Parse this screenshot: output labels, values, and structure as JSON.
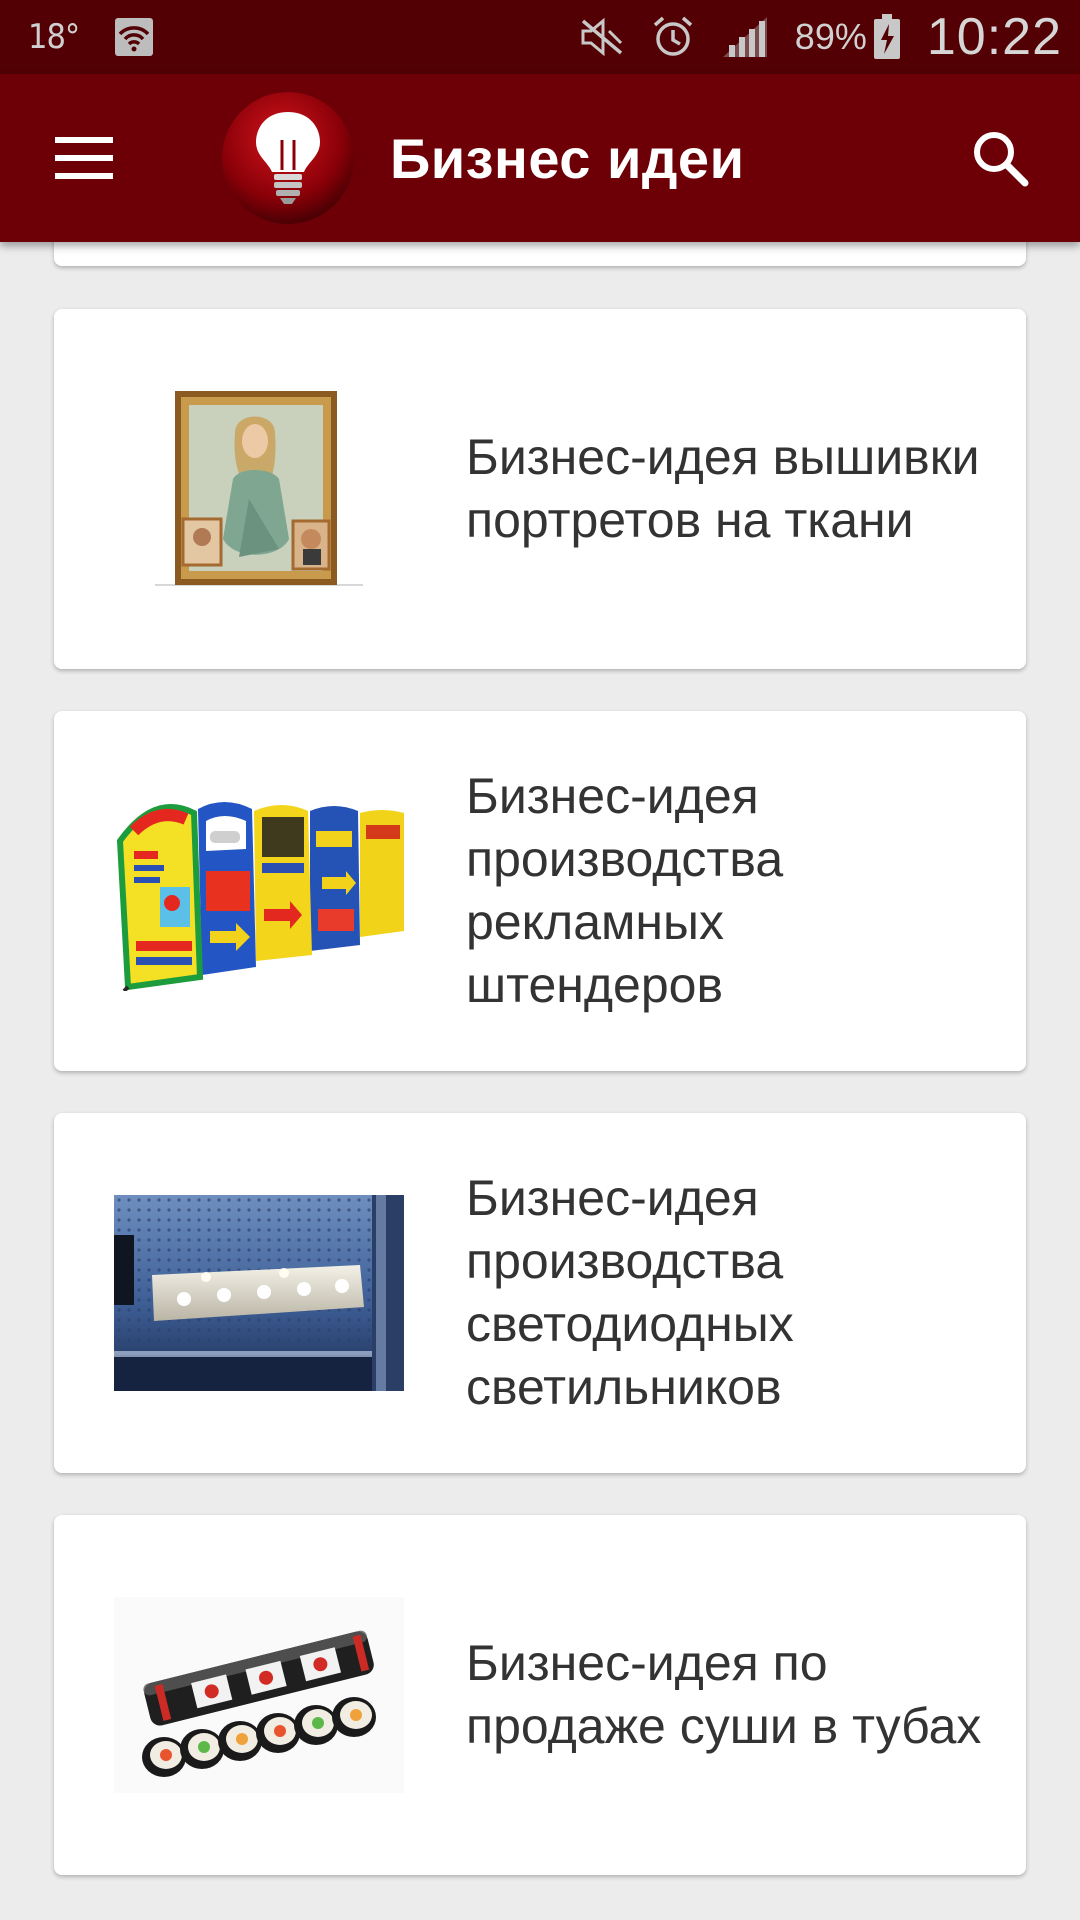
{
  "status_bar": {
    "temperature": "18°",
    "battery": "89%",
    "time": "10:22",
    "icons": [
      "wifi-icon",
      "mute-icon",
      "alarm-icon",
      "signal-icon",
      "battery-charging-icon"
    ]
  },
  "app_bar": {
    "title": "Бизнес идеи",
    "menu_icon": "hamburger-menu-icon",
    "logo": "lightbulb-logo",
    "search_icon": "search-icon"
  },
  "ideas": [
    {
      "title": "Бизнес-идея вышивки портретов на ткани",
      "image": "embroidered-portrait-image"
    },
    {
      "title": "Бизнес-идея производства рекламных штендеров",
      "image": "advertising-boards-image"
    },
    {
      "title": "Бизнес-идея производства светодиодных светильников",
      "image": "led-lamp-image"
    },
    {
      "title": "Бизнес-идея по продаже суши в тубах",
      "image": "sushi-tubes-image"
    }
  ],
  "colors": {
    "status_bar": "#520003",
    "app_bar": "#6d0007",
    "background": "#ececec",
    "card": "#ffffff",
    "text": "#333333"
  }
}
